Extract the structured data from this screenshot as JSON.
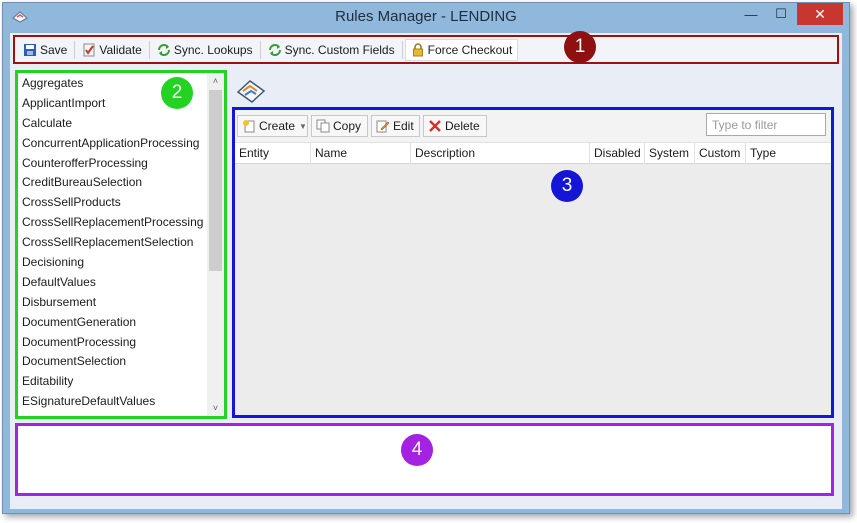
{
  "window": {
    "title": "Rules Manager - LENDING",
    "min_glyph": "—",
    "max_glyph": "☐",
    "close_glyph": "✕"
  },
  "toolbar": {
    "save": "Save",
    "validate": "Validate",
    "sync_lookups": "Sync. Lookups",
    "sync_custom_fields": "Sync. Custom Fields",
    "force_checkout": "Force Checkout"
  },
  "rule_list": {
    "items": [
      "Aggregates",
      "ApplicantImport",
      "Calculate",
      "ConcurrentApplicationProcessing",
      "CounterofferProcessing",
      "CreditBureauSelection",
      "CrossSellProducts",
      "CrossSellReplacementProcessing",
      "CrossSellReplacementSelection",
      "Decisioning",
      "DefaultValues",
      "Disbursement",
      "DocumentGeneration",
      "DocumentProcessing",
      "DocumentSelection",
      "Editability",
      "ESignatureDefaultValues"
    ],
    "scroll_up": "˄",
    "scroll_down": "˅"
  },
  "grid": {
    "create": "Create",
    "copy": "Copy",
    "edit": "Edit",
    "delete": "Delete",
    "filter_placeholder": "Type to filter",
    "columns": [
      "Entity",
      "Name",
      "Description",
      "Disabled",
      "System",
      "Custom",
      "Type"
    ]
  },
  "callouts": [
    "1",
    "2",
    "3",
    "4"
  ],
  "colors": {
    "callout_1": "#8e1010",
    "callout_2": "#22d322",
    "callout_3": "#1515d6",
    "callout_4": "#a422e2"
  }
}
